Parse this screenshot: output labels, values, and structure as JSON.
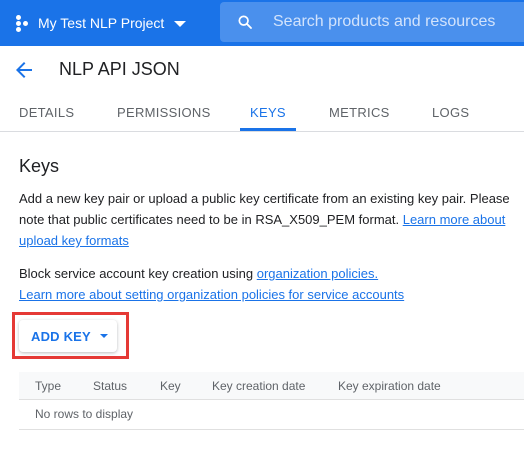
{
  "header": {
    "project_name": "My Test NLP Project",
    "search_placeholder": "Search products and resources"
  },
  "page": {
    "title": "NLP API JSON"
  },
  "tabs": [
    {
      "label": "DETAILS"
    },
    {
      "label": "PERMISSIONS"
    },
    {
      "label": "KEYS",
      "active": true
    },
    {
      "label": "METRICS"
    },
    {
      "label": "LOGS"
    }
  ],
  "keys_section": {
    "heading": "Keys",
    "intro_text": "Add a new key pair or upload a public key certificate from an existing key pair. Please note that public certificates need to be in RSA_X509_PEM format. ",
    "intro_link": "Learn more about upload key formats",
    "block_text": "Block service account key creation using ",
    "block_link": "organization policies.",
    "policy_link": "Learn more about setting organization policies for service accounts",
    "add_key_label": "ADD KEY"
  },
  "table": {
    "columns": [
      "Type",
      "Status",
      "Key",
      "Key creation date",
      "Key expiration date"
    ],
    "empty_message": "No rows to display"
  },
  "colors": {
    "accent": "#1a73e8",
    "highlight_box": "#e53935"
  }
}
